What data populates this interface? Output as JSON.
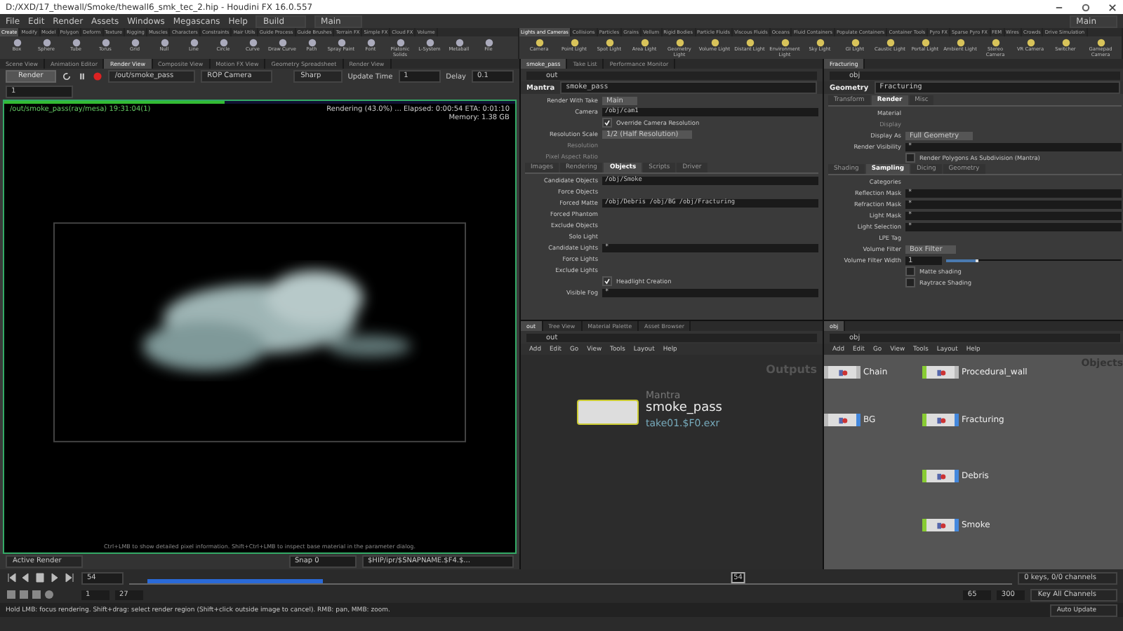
{
  "window": {
    "title": "D:/XXD/17_thewall/Smoke/thewall6_smk_tec_2.hip - Houdini FX 16.0.557"
  },
  "menu": [
    "File",
    "Edit",
    "Render",
    "Assets",
    "Windows",
    "Megascans",
    "Help"
  ],
  "desktop": "Build",
  "workspace": "Main",
  "workspace_right": "Main",
  "shelf_left": {
    "tabs": [
      {
        "label": "Create",
        "selected": true
      },
      {
        "label": "Modify",
        "selected": false
      },
      {
        "label": "Model",
        "selected": false
      },
      {
        "label": "Polygon",
        "selected": false
      },
      {
        "label": "Deform",
        "selected": false
      },
      {
        "label": "Texture",
        "selected": false
      },
      {
        "label": "Rigging",
        "selected": false
      },
      {
        "label": "Muscles",
        "selected": false
      },
      {
        "label": "Characters",
        "selected": false
      },
      {
        "label": "Constraints",
        "selected": false
      },
      {
        "label": "Hair Utils",
        "selected": false
      },
      {
        "label": "Guide Process",
        "selected": false
      },
      {
        "label": "Guide Brushes",
        "selected": false
      },
      {
        "label": "Terrain FX",
        "selected": false
      },
      {
        "label": "Simple FX",
        "selected": false
      },
      {
        "label": "Cloud FX",
        "selected": false
      },
      {
        "label": "Volume",
        "selected": false
      }
    ],
    "tools": [
      "Box",
      "Sphere",
      "Tube",
      "Torus",
      "Grid",
      "Null",
      "Line",
      "Circle",
      "Curve",
      "Draw Curve",
      "Path",
      "Spray Paint",
      "Font",
      "Platonic Solids",
      "L-System",
      "Metaball",
      "File"
    ]
  },
  "shelf_right": {
    "tabs": [
      {
        "label": "Lights and Cameras",
        "selected": true
      },
      {
        "label": "Collisions",
        "selected": false
      },
      {
        "label": "Particles",
        "selected": false
      },
      {
        "label": "Grains",
        "selected": false
      },
      {
        "label": "Vellum",
        "selected": false
      },
      {
        "label": "Rigid Bodies",
        "selected": false
      },
      {
        "label": "Particle Fluids",
        "selected": false
      },
      {
        "label": "Viscous Fluids",
        "selected": false
      },
      {
        "label": "Oceans",
        "selected": false
      },
      {
        "label": "Fluid Containers",
        "selected": false
      },
      {
        "label": "Populate Containers",
        "selected": false
      },
      {
        "label": "Container Tools",
        "selected": false
      },
      {
        "label": "Pyro FX",
        "selected": false
      },
      {
        "label": "Sparse Pyro FX",
        "selected": false
      },
      {
        "label": "FEM",
        "selected": false
      },
      {
        "label": "Wires",
        "selected": false
      },
      {
        "label": "Crowds",
        "selected": false
      },
      {
        "label": "Drive Simulation",
        "selected": false
      }
    ],
    "tools": [
      "Camera",
      "Point Light",
      "Spot Light",
      "Area Light",
      "Geometry Light",
      "Volume Light",
      "Distant Light",
      "Environment Light",
      "Sky Light",
      "GI Light",
      "Caustic Light",
      "Portal Light",
      "Ambient Light",
      "Stereo Camera",
      "VR Camera",
      "Switcher",
      "Gamepad Camera"
    ]
  },
  "render_view": {
    "tabs": [
      {
        "label": "Scene View",
        "selected": false
      },
      {
        "label": "Animation Editor",
        "selected": false
      },
      {
        "label": "Render View",
        "selected": true
      },
      {
        "label": "Composite View",
        "selected": false
      },
      {
        "label": "Motion FX View",
        "selected": false
      },
      {
        "label": "Geometry Spreadsheet",
        "selected": false
      },
      {
        "label": "Render View",
        "selected": false
      }
    ],
    "render_button": "Render",
    "rop": "/out/smoke_pass",
    "camera": "ROP Camera",
    "mode": "Sharp",
    "update_label": "Update Time",
    "update_value": "1",
    "delay_label": "Delay",
    "delay_value": "0.1",
    "zoom": "1",
    "header": "/out/smoke_pass(ray/mesa) 19:31:04(1)",
    "status": "Rendering (43.0%) ...   Elapsed: 0:00:54   ETA: 0:01:10",
    "memory": "Memory:   1.38 GB",
    "level": 0.43,
    "hint": "Ctrl+LMB to show detailed pixel information. Shift+Ctrl+LMB to inspect base material in the parameter dialog.",
    "active_render": "Active Render",
    "snap": "Snap  0",
    "snap_path": "$HIP/ipr/$SNAPNAME.$F4.$..."
  },
  "params_left": {
    "tabs": [
      {
        "label": "smoke_pass",
        "selected": true
      },
      {
        "label": "Take List",
        "selected": false
      },
      {
        "label": "Performance Monitor",
        "selected": false
      }
    ],
    "path": "out",
    "node_type": "Mantra",
    "node_name": "smoke_pass",
    "rows": [
      {
        "kind": "menu",
        "label": "Render With Take",
        "value": "Main"
      },
      {
        "kind": "field",
        "label": "Camera",
        "value": "/obj/cam1"
      },
      {
        "kind": "check",
        "label": "Override Camera Resolution",
        "checked": true
      },
      {
        "kind": "menu",
        "label": "Resolution Scale",
        "value": "1/2 (Half Resolution)"
      },
      {
        "kind": "field",
        "label": "Resolution",
        "value": "",
        "disabled": true
      },
      {
        "kind": "field",
        "label": "Pixel Aspect Ratio",
        "value": "",
        "disabled": true
      },
      {
        "kind": "tabs",
        "tabs": [
          {
            "label": "Images",
            "selected": false
          },
          {
            "label": "Rendering",
            "selected": false
          },
          {
            "label": "Objects",
            "selected": true
          },
          {
            "label": "Scripts",
            "selected": false
          },
          {
            "label": "Driver",
            "selected": false
          }
        ]
      },
      {
        "kind": "field",
        "label": "Candidate Objects",
        "value": "/obj/Smoke"
      },
      {
        "kind": "field",
        "label": "Force Objects",
        "value": ""
      },
      {
        "kind": "field",
        "label": "Forced Matte",
        "value": "/obj/Debris /obj/BG /obj/Fracturing"
      },
      {
        "kind": "field",
        "label": "Forced Phantom",
        "value": ""
      },
      {
        "kind": "field",
        "label": "Exclude Objects",
        "value": ""
      },
      {
        "kind": "field",
        "label": "Solo Light",
        "value": ""
      },
      {
        "kind": "field",
        "label": "Candidate Lights",
        "value": "*"
      },
      {
        "kind": "field",
        "label": "Force Lights",
        "value": ""
      },
      {
        "kind": "field",
        "label": "Exclude Lights",
        "value": ""
      },
      {
        "kind": "check",
        "label": "Headlight Creation",
        "checked": true
      },
      {
        "kind": "field",
        "label": "Visible Fog",
        "value": "*"
      }
    ]
  },
  "params_right": {
    "tabs": [
      {
        "label": "Fracturing",
        "selected": true
      }
    ],
    "path": "obj",
    "node_type": "Geometry",
    "node_name": "Fracturing",
    "rows": [
      {
        "kind": "tabs",
        "tabs": [
          {
            "label": "Transform",
            "selected": false
          },
          {
            "label": "Render",
            "selected": true
          },
          {
            "label": "Misc",
            "selected": false
          }
        ]
      },
      {
        "kind": "field",
        "label": "Material",
        "value": ""
      },
      {
        "kind": "field",
        "label": "Display",
        "value": "",
        "disabled": true
      },
      {
        "kind": "menu",
        "label": "Display As",
        "value": "Full Geometry"
      },
      {
        "kind": "field",
        "label": "Render Visibility",
        "value": "*"
      },
      {
        "kind": "check",
        "label": "Render Polygons As Subdivision (Mantra)",
        "checked": false
      },
      {
        "kind": "tabs",
        "tabs": [
          {
            "label": "Shading",
            "selected": false
          },
          {
            "label": "Sampling",
            "selected": true
          },
          {
            "label": "Dicing",
            "selected": false
          },
          {
            "label": "Geometry",
            "selected": false
          }
        ]
      },
      {
        "kind": "field",
        "label": "Categories",
        "value": ""
      },
      {
        "kind": "field",
        "label": "Reflection Mask",
        "value": "*"
      },
      {
        "kind": "field",
        "label": "Refraction Mask",
        "value": "*"
      },
      {
        "kind": "field",
        "label": "Light Mask",
        "value": "*"
      },
      {
        "kind": "field",
        "label": "Light Selection",
        "value": "*"
      },
      {
        "kind": "field",
        "label": "LPE Tag",
        "value": ""
      },
      {
        "kind": "menu",
        "label": "Volume Filter",
        "value": "Box Filter"
      },
      {
        "kind": "slider",
        "label": "Volume Filter Width",
        "value": "1",
        "level": 0.17
      },
      {
        "kind": "check",
        "label": "Matte shading",
        "checked": false
      },
      {
        "kind": "check",
        "label": "Raytrace Shading",
        "checked": false
      }
    ]
  },
  "network_left": {
    "tabs": [
      {
        "label": "out",
        "selected": true
      },
      {
        "label": "Tree View",
        "selected": false
      },
      {
        "label": "Material Palette",
        "selected": false
      },
      {
        "label": "Asset Browser",
        "selected": false
      }
    ],
    "path": "out",
    "menu": [
      "Add",
      "Edit",
      "Go",
      "View",
      "Tools",
      "Layout",
      "Help"
    ],
    "context": "Outputs",
    "node": {
      "type": "Mantra",
      "name": "smoke_pass",
      "output": "take01.$F0.exr"
    }
  },
  "network_right": {
    "tabs": [
      {
        "label": "obj",
        "selected": true
      }
    ],
    "path": "obj",
    "menu": [
      "Add",
      "Edit",
      "Go",
      "View",
      "Tools",
      "Layout",
      "Help"
    ],
    "context": "Objects",
    "nodes": [
      {
        "name": "Chain",
        "display": false,
        "render": false
      },
      {
        "name": "BG",
        "display": false,
        "render": true
      },
      {
        "name": "Procedural_wall",
        "display": true,
        "render": false
      },
      {
        "name": "Fracturing",
        "display": true,
        "render": true
      },
      {
        "name": "Debris",
        "display": true,
        "render": true
      },
      {
        "name": "Smoke",
        "display": true,
        "render": true
      }
    ]
  },
  "timeline": {
    "frame": "54",
    "playhead_label": "54",
    "level": 0.69,
    "start": "1",
    "end": "27",
    "range_start": "65",
    "range_end": "300",
    "keys": "0 keys, 0/0 channels",
    "key_all": "Key All Channels",
    "auto_update": "Auto Update"
  },
  "status_bar": "Hold LMB: focus rendering. Shift+drag: select render region (Shift+click outside image to cancel). RMB: pan, MMB: zoom."
}
